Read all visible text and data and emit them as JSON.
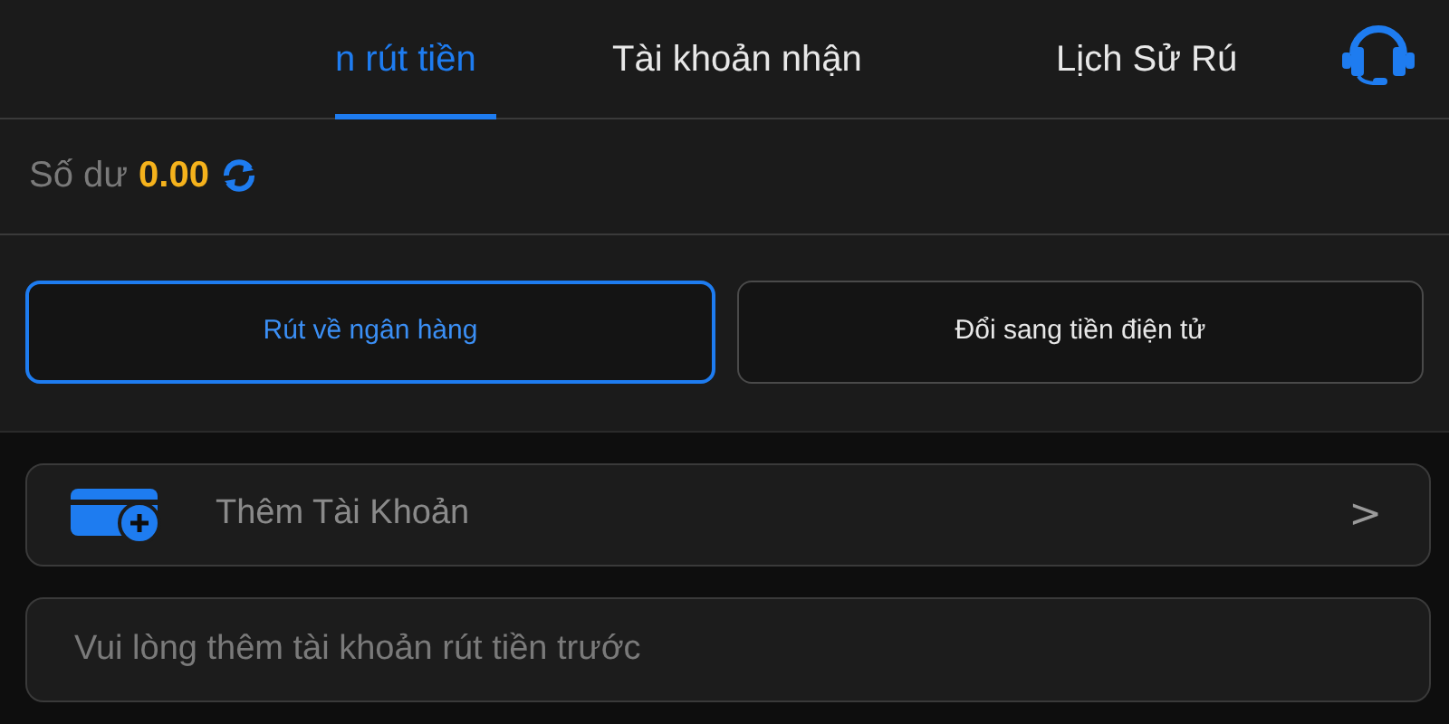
{
  "tabs": [
    {
      "label": "n rút tiền",
      "selected": true
    },
    {
      "label": "Tài khoản nhận",
      "selected": false
    },
    {
      "label": "Lịch Sử Rú",
      "selected": false
    }
  ],
  "balance": {
    "label": "Số dư",
    "amount": "0.00"
  },
  "methods": [
    {
      "label": "Rút về ngân hàng",
      "selected": true
    },
    {
      "label": "Đổi sang tiền điện tử",
      "selected": false
    }
  ],
  "add_account": {
    "label": "Thêm Tài Khoản",
    "chevron": ">"
  },
  "notice_field": {
    "placeholder": "Vui lòng thêm tài khoản rút tiền trước"
  }
}
